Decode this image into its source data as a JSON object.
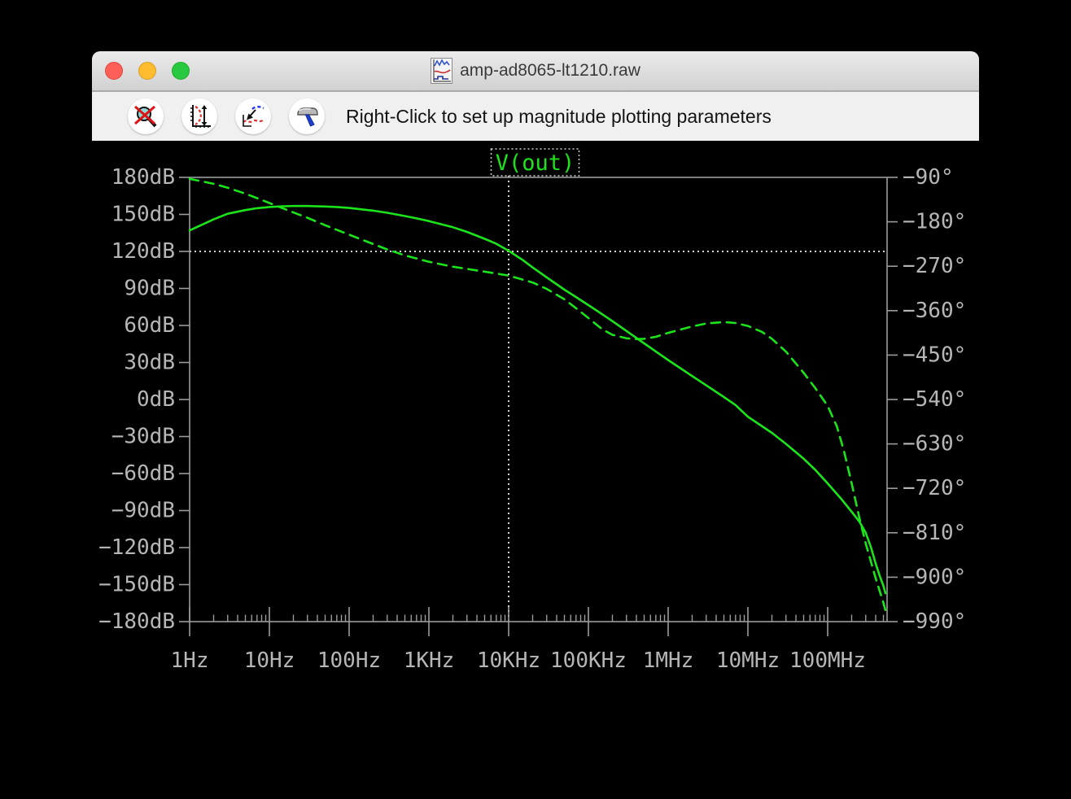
{
  "window": {
    "title": "amp-ad8065-lt1210.raw",
    "traffic_lights": {
      "close": "#ff5f57",
      "minimize": "#febc2e",
      "zoom": "#28c840"
    }
  },
  "toolbar": {
    "status_text": "Right-Click to set up magnitude plotting parameters",
    "buttons": [
      {
        "icon": "zoom-back-icon"
      },
      {
        "icon": "autorange-y-icon"
      },
      {
        "icon": "zoom-to-fit-icon"
      },
      {
        "icon": "control-panel-hammer-icon"
      }
    ]
  },
  "plot": {
    "trace_label": "V(out)",
    "colors": {
      "trace": "#1be41b",
      "axis": "#9b9b9b",
      "label": "#b6b6b6",
      "cursor": "#d0d0d0",
      "background": "#000000"
    },
    "left_axis": {
      "unit": "dB",
      "ticks": [
        "180dB",
        "150dB",
        "120dB",
        "90dB",
        "60dB",
        "30dB",
        "0dB",
        "−30dB",
        "−60dB",
        "−90dB",
        "−120dB",
        "−150dB",
        "−180dB"
      ]
    },
    "right_axis": {
      "unit": "deg",
      "ticks": [
        "−90°",
        "−180°",
        "−270°",
        "−360°",
        "−450°",
        "−540°",
        "−630°",
        "−720°",
        "−810°",
        "−900°",
        "−990°"
      ]
    },
    "x_axis": {
      "ticks": [
        "1Hz",
        "10Hz",
        "100Hz",
        "1KHz",
        "10KHz",
        "100KHz",
        "1MHz",
        "10MHz",
        "100MHz"
      ]
    },
    "cursor": {
      "frequency_hz": 10000,
      "level_db": 120,
      "frequency_label": "10KHz",
      "level_label": "120dB"
    }
  },
  "chart_data": {
    "type": "line",
    "title": "V(out)",
    "x_scale": "log",
    "xlabel_ticks_hz": [
      1,
      10,
      100,
      1000,
      10000,
      100000,
      1000000,
      10000000,
      100000000
    ],
    "x_range_hz": [
      1,
      550000000
    ],
    "ylim_left_dB": [
      -180,
      180
    ],
    "ylim_right_deg": [
      -990,
      -90
    ],
    "grid": false,
    "legend_position": "top-center",
    "series": [
      {
        "name": "V(out) magnitude (dB)",
        "style": "solid",
        "axis": "left",
        "points": [
          [
            1,
            137
          ],
          [
            2,
            146
          ],
          [
            3,
            150.5
          ],
          [
            5,
            153.5
          ],
          [
            7,
            155
          ],
          [
            10,
            156
          ],
          [
            15,
            156.6
          ],
          [
            20,
            156.8
          ],
          [
            30,
            156.8
          ],
          [
            50,
            156.4
          ],
          [
            70,
            156
          ],
          [
            100,
            155.2
          ],
          [
            200,
            153
          ],
          [
            300,
            151.3
          ],
          [
            500,
            148.7
          ],
          [
            700,
            146.8
          ],
          [
            1000,
            144.6
          ],
          [
            2000,
            139.6
          ],
          [
            3000,
            135.8
          ],
          [
            5000,
            130.2
          ],
          [
            7000,
            126.2
          ],
          [
            10000,
            120.5
          ],
          [
            15000,
            113
          ],
          [
            20000,
            107
          ],
          [
            30000,
            99
          ],
          [
            50000,
            89
          ],
          [
            70000,
            83
          ],
          [
            100000,
            76.5
          ],
          [
            150000,
            69
          ],
          [
            200000,
            63.5
          ],
          [
            300000,
            55.5
          ],
          [
            500000,
            45.5
          ],
          [
            700000,
            39
          ],
          [
            1000000,
            32
          ],
          [
            2000000,
            19
          ],
          [
            3000000,
            11.5
          ],
          [
            5000000,
            2
          ],
          [
            7000000,
            -4.5
          ],
          [
            10000000,
            -14
          ],
          [
            20000000,
            -27
          ],
          [
            30000000,
            -36
          ],
          [
            50000000,
            -48
          ],
          [
            70000000,
            -57
          ],
          [
            100000000,
            -68
          ],
          [
            150000000,
            -81
          ],
          [
            200000000,
            -91
          ],
          [
            250000000,
            -99
          ],
          [
            300000000,
            -108
          ],
          [
            350000000,
            -120
          ],
          [
            400000000,
            -133
          ],
          [
            450000000,
            -143
          ],
          [
            500000000,
            -151
          ],
          [
            530000000,
            -157
          ]
        ]
      },
      {
        "name": "V(out) phase (deg)",
        "style": "dashed",
        "axis": "right",
        "points": [
          [
            1,
            -93
          ],
          [
            2,
            -103
          ],
          [
            3,
            -111
          ],
          [
            5,
            -123
          ],
          [
            7,
            -132
          ],
          [
            10,
            -142
          ],
          [
            20,
            -161
          ],
          [
            30,
            -172
          ],
          [
            50,
            -187
          ],
          [
            100,
            -206
          ],
          [
            200,
            -225
          ],
          [
            300,
            -236
          ],
          [
            500,
            -248
          ],
          [
            1000,
            -261
          ],
          [
            2000,
            -271
          ],
          [
            5000,
            -281
          ],
          [
            10000,
            -289
          ],
          [
            20000,
            -303
          ],
          [
            30000,
            -316
          ],
          [
            50000,
            -337
          ],
          [
            70000,
            -355
          ],
          [
            100000,
            -375
          ],
          [
            150000,
            -398
          ],
          [
            200000,
            -409
          ],
          [
            300000,
            -416
          ],
          [
            400000,
            -417.5
          ],
          [
            500000,
            -417
          ],
          [
            700000,
            -413
          ],
          [
            1000000,
            -405
          ],
          [
            2000000,
            -392
          ],
          [
            3000000,
            -386
          ],
          [
            5000000,
            -383
          ],
          [
            7000000,
            -385
          ],
          [
            10000000,
            -391
          ],
          [
            15000000,
            -403
          ],
          [
            20000000,
            -417
          ],
          [
            30000000,
            -443
          ],
          [
            50000000,
            -486
          ],
          [
            70000000,
            -517
          ],
          [
            100000000,
            -553
          ],
          [
            130000000,
            -594
          ],
          [
            160000000,
            -644
          ],
          [
            200000000,
            -710
          ],
          [
            250000000,
            -780
          ],
          [
            300000000,
            -832
          ],
          [
            400000000,
            -902
          ],
          [
            500000000,
            -952
          ],
          [
            540000000,
            -972
          ]
        ]
      }
    ]
  }
}
